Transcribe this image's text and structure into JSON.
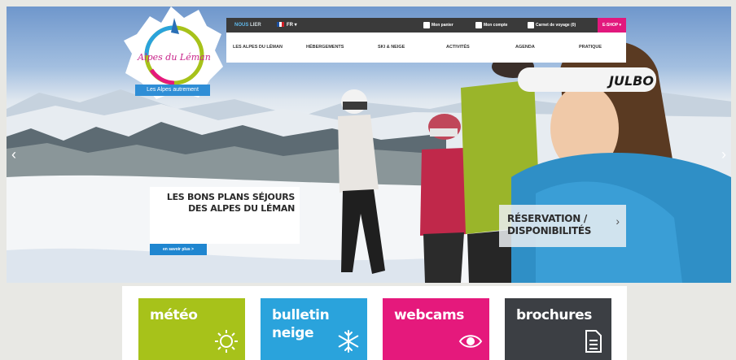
{
  "logo": {
    "text": "Alpes du Léman",
    "tagline": "Les Alpes autrement"
  },
  "topbar": {
    "lang_tab_a": "NOUS",
    "lang_tab_b": "LIER",
    "language": "FR",
    "links": [
      "Mon panier",
      "Mon compte",
      "Carnet de voyage (0)"
    ],
    "shop": "E-SHOP"
  },
  "nav": [
    "LES ALPES DU LÉMAN",
    "HÉBERGEMENTS",
    "SKI & NEIGE",
    "ACTIVITÉS",
    "AGENDA",
    "PRATIQUE"
  ],
  "hero": {
    "promo_line1": "LES BONS PLANS SÉJOURS",
    "promo_line2": "DES ALPES DU LÉMAN",
    "promo_button": "en savoir plus >",
    "resa_line1": "RÉSERVATION /",
    "resa_line2": "DISPONIBILITÉS",
    "resa_chevron": "›",
    "prev": "‹",
    "next": "›",
    "goggle_brand": "JULBO"
  },
  "tiles": [
    {
      "line1": "météo",
      "line2": "",
      "color": "#a7c21a",
      "icon": "sun-icon"
    },
    {
      "line1": "bulletin",
      "line2": "neige",
      "color": "#2aa3dc",
      "icon": "snowflake-icon"
    },
    {
      "line1": "webcams",
      "line2": "",
      "color": "#e5197c",
      "icon": "eye-icon"
    },
    {
      "line1": "brochures",
      "line2": "",
      "color": "#3c3f44",
      "icon": "document-icon"
    }
  ]
}
